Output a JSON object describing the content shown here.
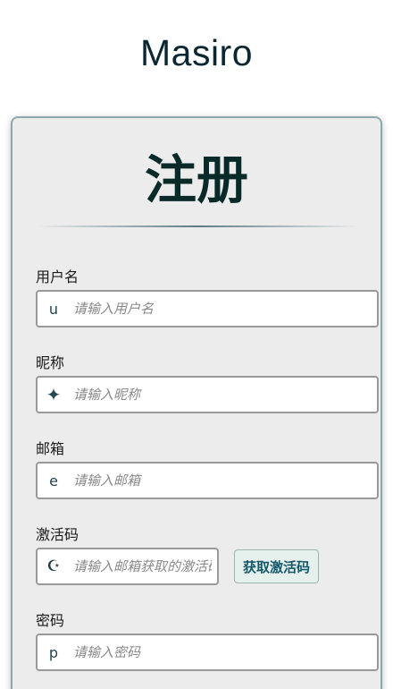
{
  "app": {
    "title": "Masiro"
  },
  "form": {
    "title": "注册",
    "fields": {
      "username": {
        "label": "用户名",
        "icon": "u",
        "placeholder": "请输入用户名",
        "value": ""
      },
      "nickname": {
        "label": "昵称",
        "icon": "✦",
        "placeholder": "请输入昵称",
        "value": ""
      },
      "email": {
        "label": "邮箱",
        "icon": "e",
        "placeholder": "请输入邮箱",
        "value": ""
      },
      "activation_code": {
        "label": "激活码",
        "icon": "☪",
        "placeholder": "请输入邮箱获取的激活码",
        "value": "",
        "button_label": "获取激活码"
      },
      "password": {
        "label": "密码",
        "icon": "p",
        "placeholder": "请输入密码",
        "value": ""
      }
    }
  }
}
